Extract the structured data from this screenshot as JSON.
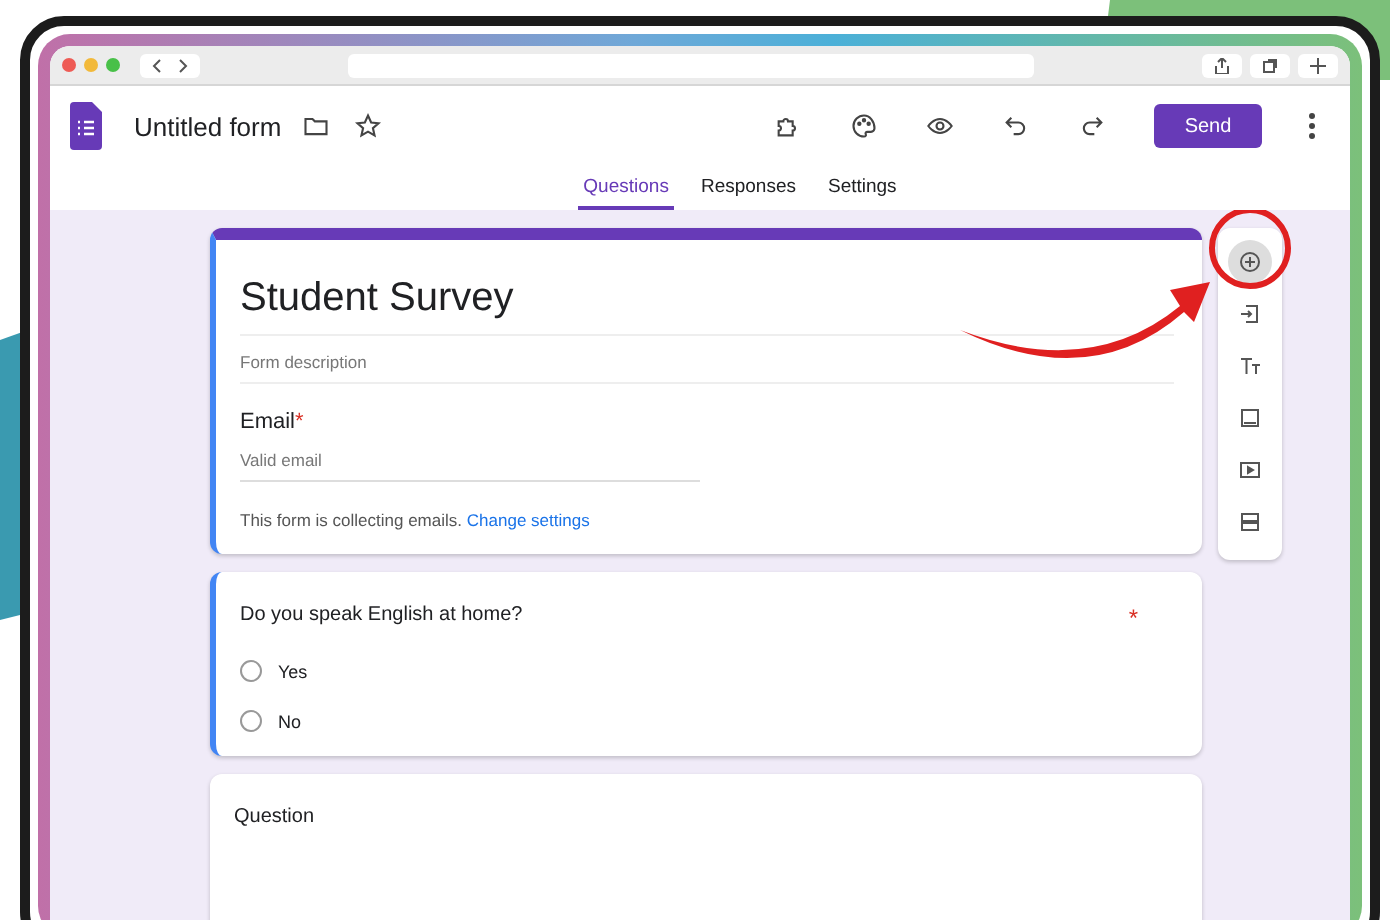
{
  "app": {
    "title": "Untitled form",
    "send": "Send"
  },
  "tabs": [
    {
      "label": "Questions",
      "selected": true
    },
    {
      "label": "Responses",
      "selected": false
    },
    {
      "label": "Settings",
      "selected": false
    }
  ],
  "header_card": {
    "title": "Student Survey",
    "description_placeholder": "Form description",
    "email_label": "Email",
    "email_required": true,
    "email_required_mark": "*",
    "email_placeholder": "Valid email",
    "note": "This form is collecting emails.",
    "note_link": "Change settings"
  },
  "question_card": {
    "question": "Do you speak English at home?",
    "required": true,
    "required_mark": "*",
    "options": [
      {
        "label": "Yes",
        "selected": false
      },
      {
        "label": "No",
        "selected": false
      }
    ]
  },
  "next_card": {
    "title": "Question"
  },
  "tools": [
    {
      "kind": "add",
      "highlighted": true
    },
    {
      "kind": "import",
      "highlighted": false
    },
    {
      "kind": "title",
      "highlighted": false
    },
    {
      "kind": "image",
      "highlighted": false
    },
    {
      "kind": "video",
      "highlighted": false
    },
    {
      "kind": "section",
      "highlighted": false
    }
  ]
}
